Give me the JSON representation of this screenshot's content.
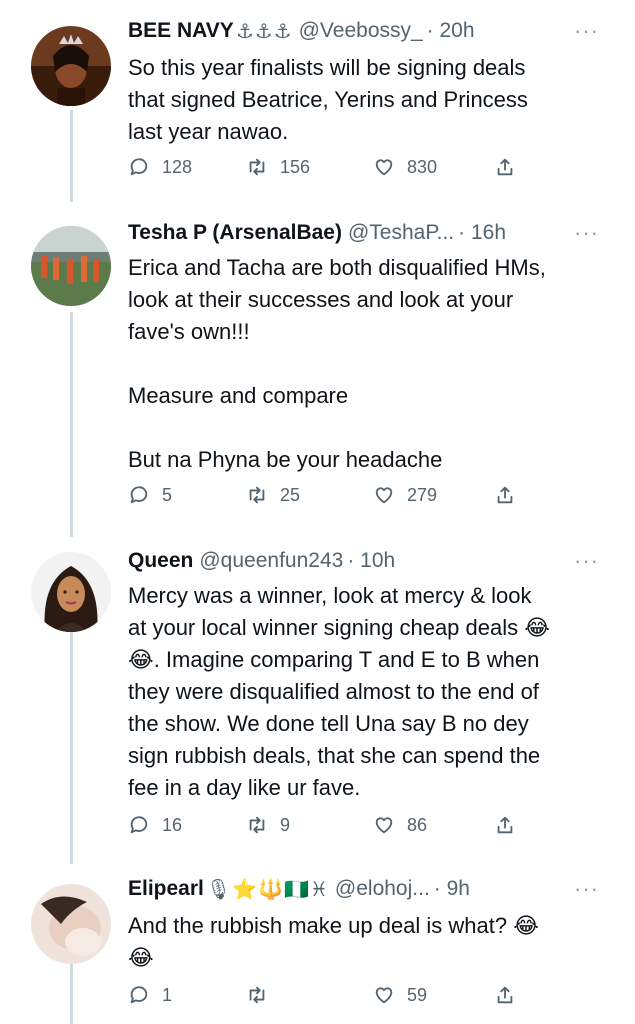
{
  "tweets": [
    {
      "name": "BEE NAVY",
      "badges": "⚓⚓⚓",
      "handle": "@Veebossy_",
      "time": "· 20h",
      "more": "···",
      "lines": [
        "So this year finalists will be signing deals",
        "that signed Beatrice, Yerins and Princess",
        "last year nawao."
      ],
      "replies": "128",
      "retweets": "156",
      "likes": "830"
    },
    {
      "name": "Tesha P (ArsenalBae)",
      "badges": "",
      "handle": "@TeshaP...",
      "time": "· 16h",
      "more": "···",
      "lines": [
        "Erica and Tacha are both disqualified HMs,",
        "look at their successes and look at your",
        "fave's own!!!",
        "",
        "Measure and compare",
        "",
        "But na Phyna be your headache"
      ],
      "replies": "5",
      "retweets": "25",
      "likes": "279"
    },
    {
      "name": "Queen",
      "badges": "",
      "handle": "@queenfun243",
      "time": "· 10h",
      "more": "···",
      "lines": [
        "Mercy was a winner, look at mercy & look",
        "at your local winner signing cheap deals 😂",
        "😂. Imagine comparing T and E to B when",
        "they were disqualified almost to the end of",
        "the show. We done tell Una say B no dey",
        "sign rubbish deals, that she can spend the",
        "fee in a day like ur fave."
      ],
      "replies": "16",
      "retweets": "9",
      "likes": "86"
    },
    {
      "name": "Elipearl",
      "badges": "🎙⭐🔱🇳🇬♓",
      "handle": "@elohoj...",
      "time": "· 9h",
      "more": "···",
      "lines": [
        "And the rubbish make up deal is what? 😂",
        "😂"
      ],
      "replies": "1",
      "retweets": "",
      "likes": "59"
    }
  ],
  "icons": {
    "reply": "reply-icon",
    "retweet": "retweet-icon",
    "like": "heart-icon",
    "share": "share-icon"
  },
  "colors": {
    "text": "#0f1419",
    "secondary": "#536471",
    "thread_line": "#cfd9de"
  }
}
